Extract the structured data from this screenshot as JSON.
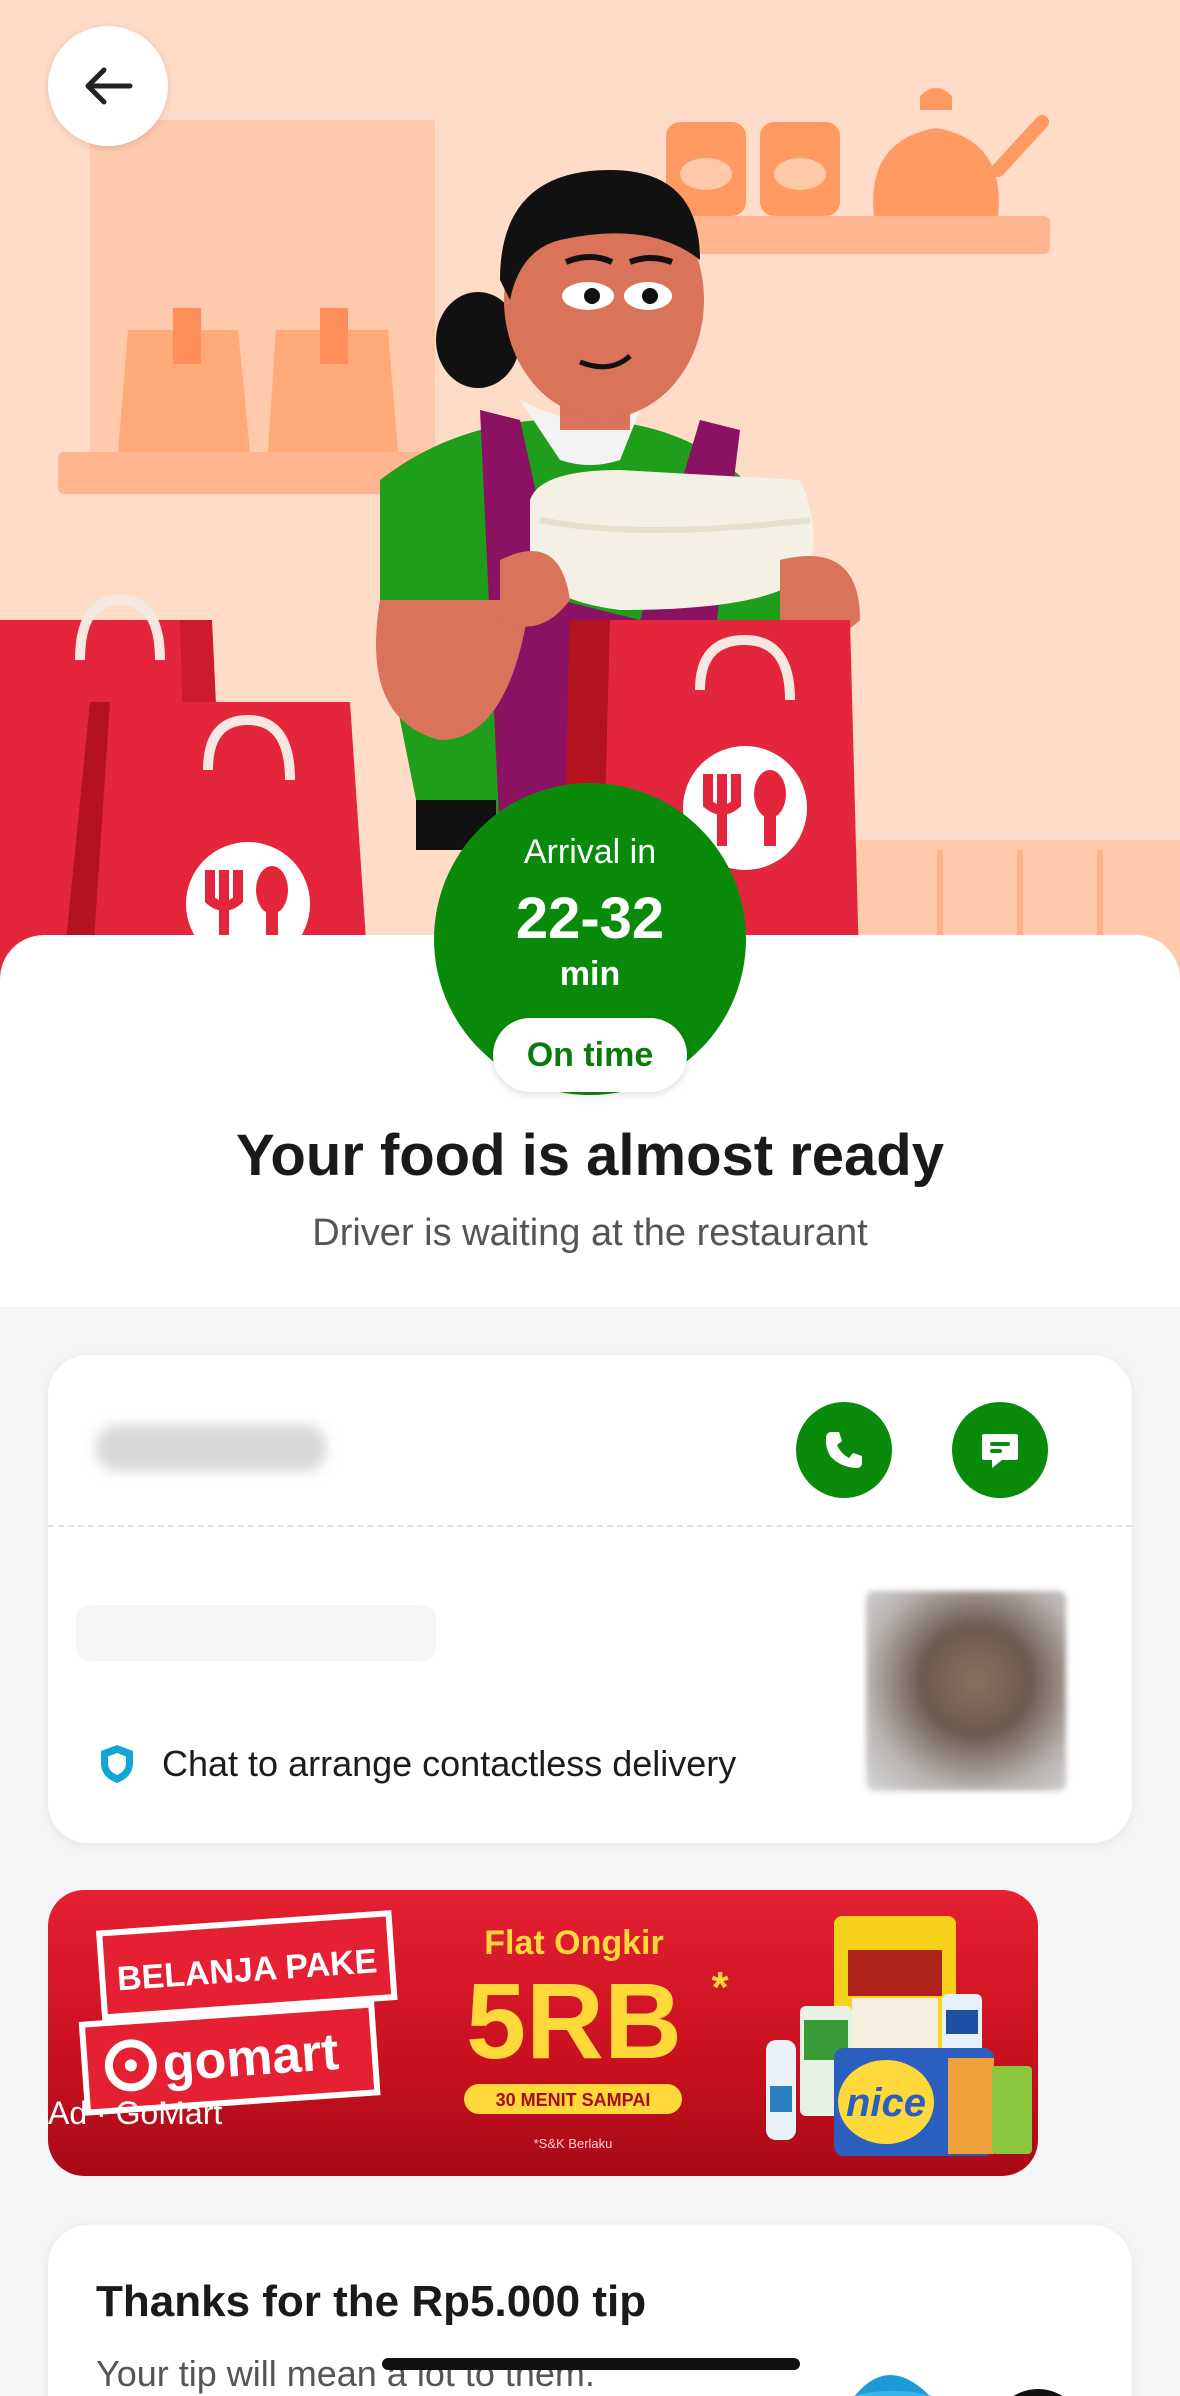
{
  "header": {
    "back_label": "Back"
  },
  "eta": {
    "label": "Arrival in",
    "value": "22-32",
    "unit": "min",
    "status": "On time"
  },
  "status": {
    "title": "Your food is almost ready",
    "subtitle": "Driver is waiting at the restaurant"
  },
  "driver": {
    "contactless_text": "Chat to arrange contactless delivery"
  },
  "ad": {
    "tag": "Ad · GoMart",
    "headline1": "BELANJA PAKE",
    "brand": "gomart",
    "offer_line": "Flat Ongkir",
    "offer_value": "5RB",
    "offer_mark": "*",
    "badge": "30 MENIT SAMPAI",
    "footnote": "*S&K Berlaku",
    "product_label": "nice"
  },
  "tip": {
    "title": "Thanks for the Rp5.000 tip",
    "subtitle": "Your tip will mean a lot to them."
  },
  "colors": {
    "brand_green": "#0a8a0a",
    "hero_bg": "#ffdcc8",
    "bag_red": "#e3263c",
    "ad_red": "#e52032"
  }
}
